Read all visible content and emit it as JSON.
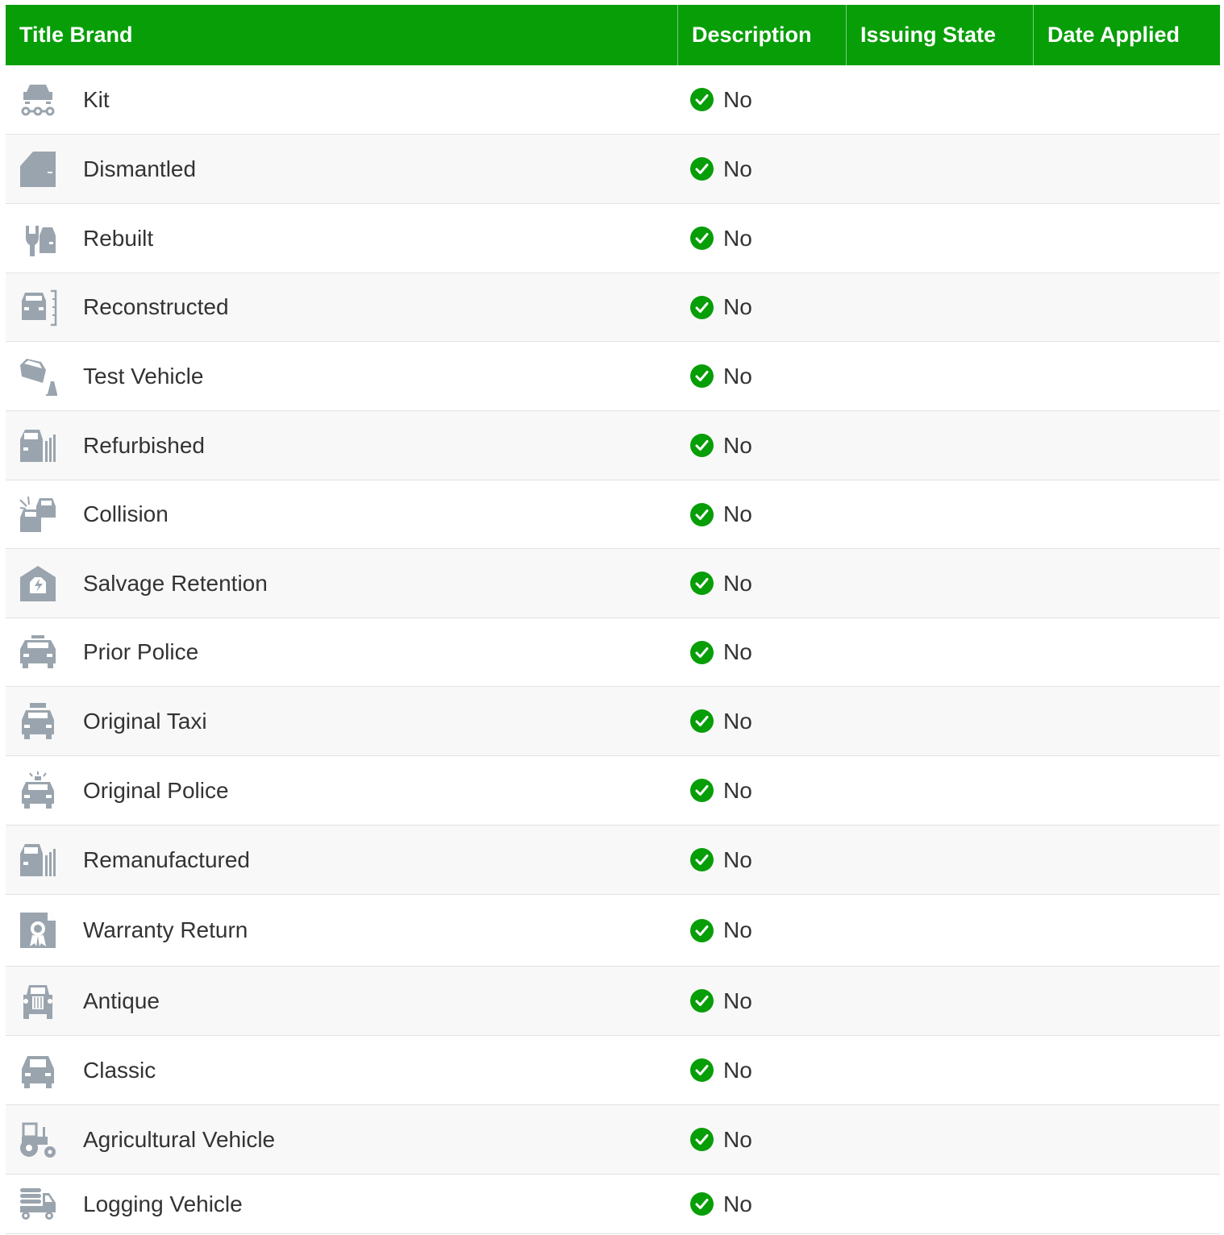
{
  "colors": {
    "header_bg": "#079e07",
    "check_green": "#079e07",
    "icon_gray": "#9aa4ae",
    "row_alt_bg": "#f8f8f8"
  },
  "table": {
    "headers": [
      "Title Brand",
      "Description",
      "Issuing State",
      "Date Applied"
    ],
    "rows": [
      {
        "title": "Kit",
        "icon": "car-chassis-icon",
        "description": "No",
        "issuing_state": "",
        "date_applied": ""
      },
      {
        "title": "Dismantled",
        "icon": "car-door-icon",
        "description": "No",
        "issuing_state": "",
        "date_applied": ""
      },
      {
        "title": "Rebuilt",
        "icon": "wrench-car-icon",
        "description": "No",
        "issuing_state": "",
        "date_applied": ""
      },
      {
        "title": "Reconstructed",
        "icon": "car-ruler-icon",
        "description": "No",
        "issuing_state": "",
        "date_applied": ""
      },
      {
        "title": "Test Vehicle",
        "icon": "crash-test-cone-icon",
        "description": "No",
        "issuing_state": "",
        "date_applied": ""
      },
      {
        "title": "Refurbished",
        "icon": "car-bars-icon",
        "description": "No",
        "issuing_state": "",
        "date_applied": ""
      },
      {
        "title": "Collision",
        "icon": "two-cars-collision-icon",
        "description": "No",
        "issuing_state": "",
        "date_applied": ""
      },
      {
        "title": "Salvage Retention",
        "icon": "salvage-garage-icon",
        "description": "No",
        "issuing_state": "",
        "date_applied": ""
      },
      {
        "title": "Prior Police",
        "icon": "police-car-icon",
        "description": "No",
        "issuing_state": "",
        "date_applied": ""
      },
      {
        "title": "Original Taxi",
        "icon": "taxi-icon",
        "description": "No",
        "issuing_state": "",
        "date_applied": ""
      },
      {
        "title": "Original Police",
        "icon": "police-siren-car-icon",
        "description": "No",
        "issuing_state": "",
        "date_applied": ""
      },
      {
        "title": "Remanufactured",
        "icon": "car-bars-icon",
        "description": "No",
        "issuing_state": "",
        "date_applied": ""
      },
      {
        "title": "Warranty Return",
        "icon": "warranty-certificate-icon",
        "description": "No",
        "issuing_state": "",
        "date_applied": ""
      },
      {
        "title": "Antique",
        "icon": "antique-car-icon",
        "description": "No",
        "issuing_state": "",
        "date_applied": ""
      },
      {
        "title": "Classic",
        "icon": "classic-car-icon",
        "description": "No",
        "issuing_state": "",
        "date_applied": ""
      },
      {
        "title": "Agricultural Vehicle",
        "icon": "tractor-icon",
        "description": "No",
        "issuing_state": "",
        "date_applied": ""
      },
      {
        "title": "Logging Vehicle",
        "icon": "logging-truck-icon",
        "description": "No",
        "issuing_state": "",
        "date_applied": ""
      }
    ]
  }
}
